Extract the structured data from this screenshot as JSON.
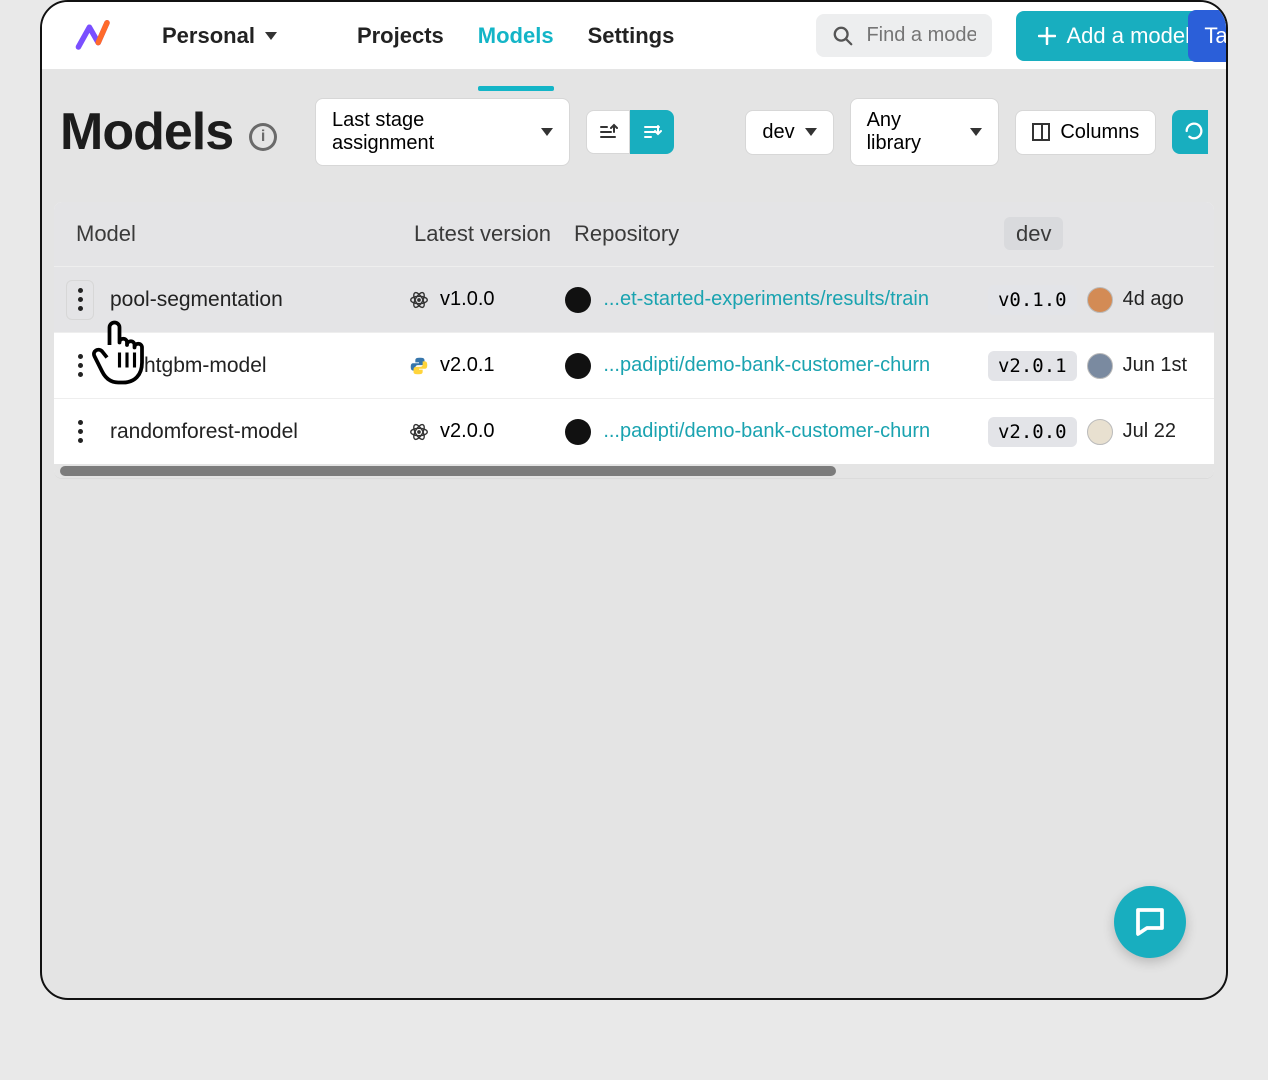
{
  "header": {
    "workspace": "Personal",
    "nav": {
      "projects": "Projects",
      "models": "Models",
      "settings": "Settings"
    },
    "search_placeholder": "Find a mode",
    "add_model": "Add a model",
    "cut_button": "Ta"
  },
  "page": {
    "title": "Models",
    "sort_label": "Last stage assignment",
    "stage_filter": "dev",
    "lib_filter": "Any library",
    "columns": "Columns"
  },
  "table": {
    "headers": {
      "model": "Model",
      "version": "Latest version",
      "repo": "Repository",
      "dev": "dev"
    },
    "rows": [
      {
        "name": "pool-segmentation",
        "version": "v1.0.0",
        "framework": "atom",
        "repo": "...et-started-experiments/results/train",
        "dev_version": "v0.1.0",
        "dev_time": "4d ago"
      },
      {
        "name": "htgbm-model",
        "version": "v2.0.1",
        "framework": "python",
        "repo": "...padipti/demo-bank-customer-churn",
        "dev_version": "v2.0.1",
        "dev_time": "Jun 1st"
      },
      {
        "name": "randomforest-model",
        "version": "v2.0.0",
        "framework": "atom",
        "repo": "...padipti/demo-bank-customer-churn",
        "dev_version": "v2.0.0",
        "dev_time": "Jul 22"
      }
    ]
  }
}
